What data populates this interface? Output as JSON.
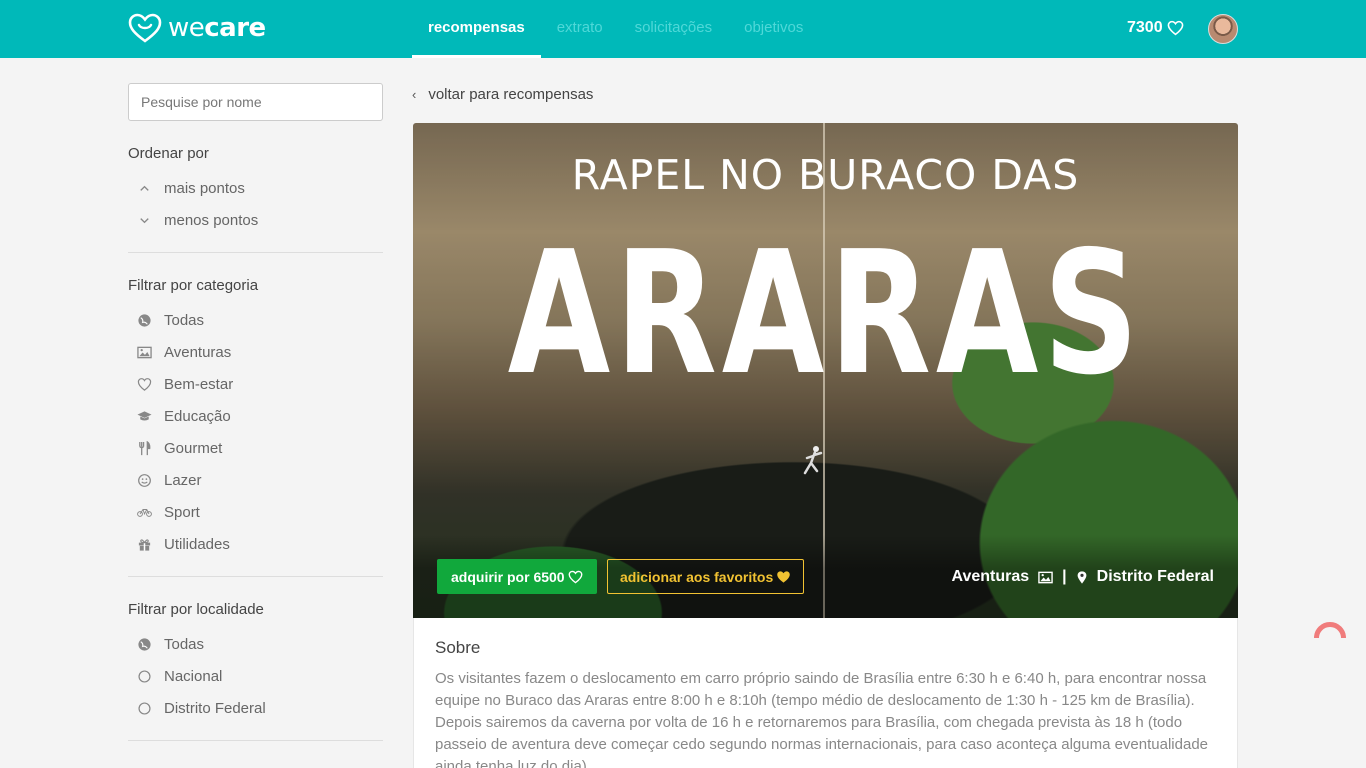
{
  "app": {
    "logo_light": "we",
    "logo_bold": "care"
  },
  "nav": {
    "tabs": [
      {
        "label": "recompensas",
        "active": true
      },
      {
        "label": "extrato"
      },
      {
        "label": "solicitações"
      },
      {
        "label": "objetivos"
      }
    ]
  },
  "user": {
    "points": "7300"
  },
  "sidebar": {
    "search_placeholder": "Pesquise por nome",
    "sort_title": "Ordenar por",
    "sort_options": [
      {
        "label": "mais pontos",
        "icon": "chevron-up-icon"
      },
      {
        "label": "menos pontos",
        "icon": "chevron-down-icon"
      }
    ],
    "category_title": "Filtrar por categoria",
    "categories": [
      {
        "label": "Todas",
        "icon": "globe-icon"
      },
      {
        "label": "Aventuras",
        "icon": "image-icon"
      },
      {
        "label": "Bem-estar",
        "icon": "heart-icon"
      },
      {
        "label": "Educação",
        "icon": "graduation-cap-icon"
      },
      {
        "label": "Gourmet",
        "icon": "cutlery-icon"
      },
      {
        "label": "Lazer",
        "icon": "smile-icon"
      },
      {
        "label": "Sport",
        "icon": "bicycle-icon"
      },
      {
        "label": "Utilidades",
        "icon": "gift-icon"
      }
    ],
    "location_title": "Filtrar por localidade",
    "locations": [
      {
        "label": "Todas",
        "icon": "globe-icon"
      },
      {
        "label": "Nacional",
        "icon": "radio-icon"
      },
      {
        "label": "Distrito Federal",
        "icon": "radio-icon"
      }
    ]
  },
  "main": {
    "back_label": "voltar para recompensas",
    "hero": {
      "subtitle": "RAPEL NO BURACO DAS",
      "title": "ARARAS",
      "buy_label": "adquirir por 6500",
      "favorite_label": "adicionar aos favoritos",
      "category": "Aventuras",
      "separator": "|",
      "location": "Distrito Federal"
    },
    "about": {
      "title": "Sobre",
      "text": "Os visitantes fazem o deslocamento em carro próprio saindo de Brasília entre 6:30 h e 6:40 h, para encontrar nossa equipe no Buraco das Araras entre 8:00 h e 8:10h (tempo médio de deslocamento de 1:30 h - 125 km de Brasília). Depois sairemos da caverna por volta de 16 h e retornaremos para Brasília, com chegada prevista às 18 h (todo passeio de aventura deve começar cedo segundo normas internacionais, para caso aconteça alguma eventualidade ainda tenha luz do dia)."
    }
  },
  "colors": {
    "brand": "#00b9b9",
    "buy": "#11a83c",
    "favorite": "#f1c232"
  }
}
